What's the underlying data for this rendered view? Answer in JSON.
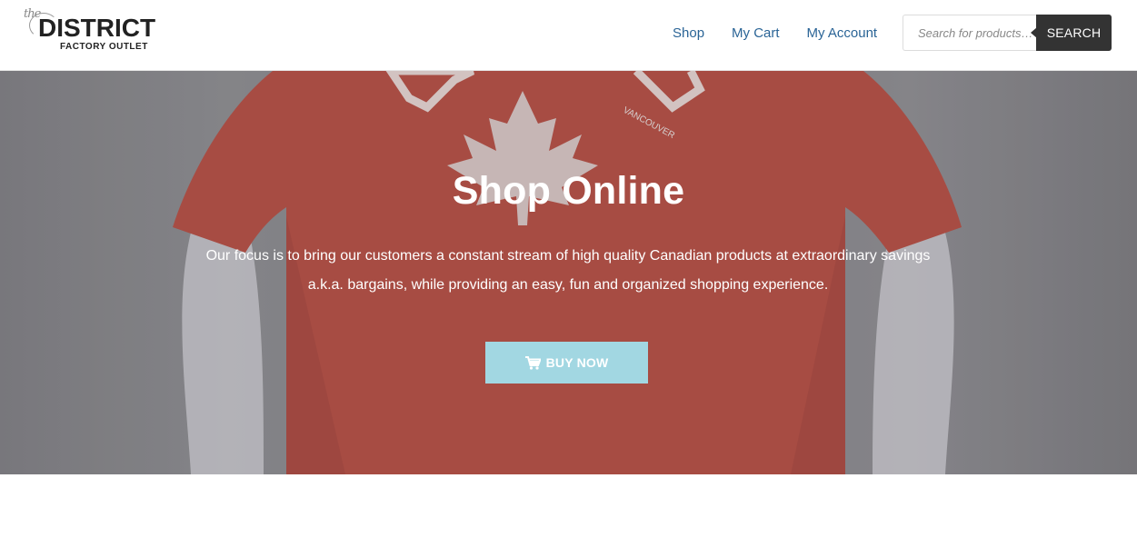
{
  "brand": {
    "prefix": "the",
    "name": "DISTRICT",
    "tagline": "FACTORY OUTLET"
  },
  "nav": {
    "items": [
      {
        "label": "Shop"
      },
      {
        "label": "My Cart"
      },
      {
        "label": "My Account"
      }
    ]
  },
  "search": {
    "placeholder": "Search for products…",
    "button_label": "SEARCH"
  },
  "hero": {
    "title": "Shop Online",
    "description": "Our focus is to bring our customers a constant stream of high quality Canadian products at extraordinary savings a.k.a. bargains, while providing an easy, fun and organized shopping experience.",
    "button_label": "BUY NOW",
    "button_icon": "shopping-cart-icon",
    "shirt_print": "VANCOUVER"
  },
  "colors": {
    "nav_link": "#2a6496",
    "search_button": "#333333",
    "buy_button": "#a2d7e2",
    "shirt": "#b24a3f"
  }
}
